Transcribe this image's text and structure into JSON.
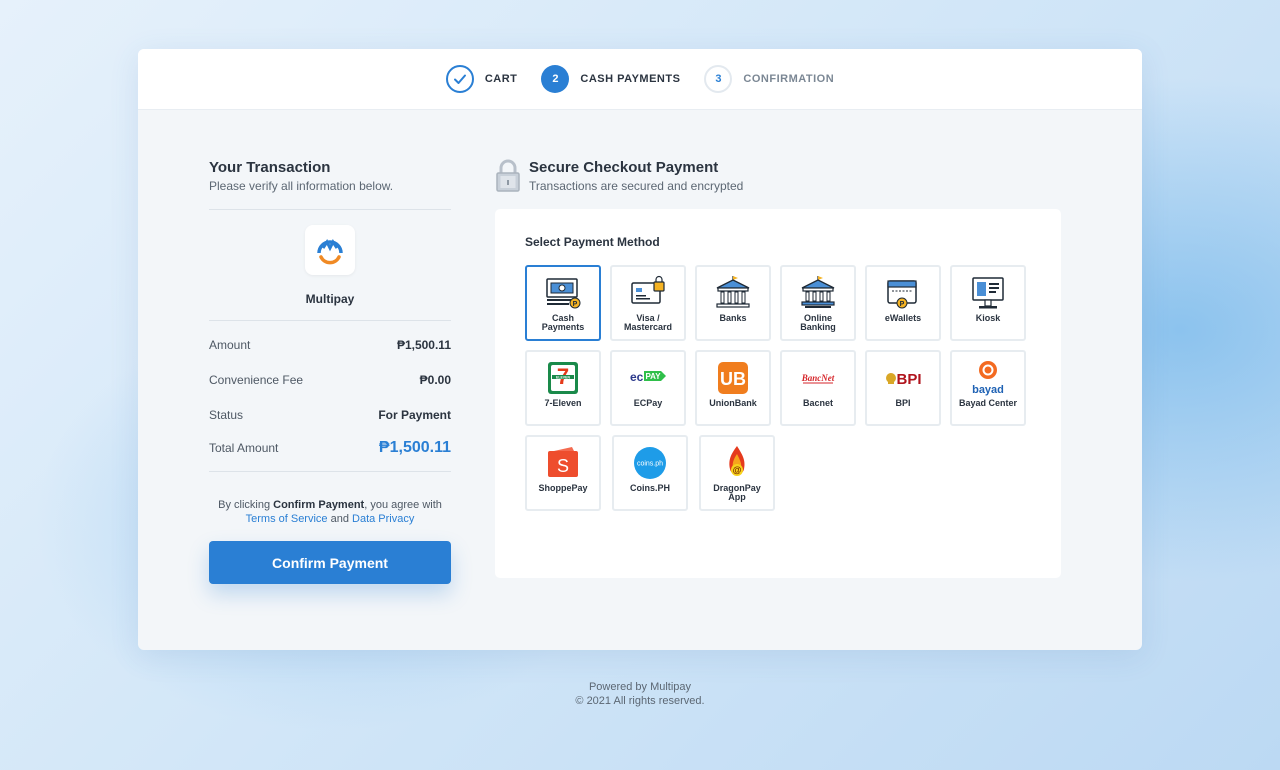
{
  "steps": [
    {
      "label": "CART",
      "number": "",
      "state": "done"
    },
    {
      "label": "CASH PAYMENTS",
      "number": "2",
      "state": "active"
    },
    {
      "label": "CONFIRMATION",
      "number": "3",
      "state": "todo"
    }
  ],
  "transaction": {
    "title": "Your Transaction",
    "subtitle": "Please verify all information below.",
    "merchant_name": "Multipay",
    "amount_label": "Amount",
    "amount_value": "₱1,500.11",
    "fee_label": "Convenience Fee",
    "fee_value": "₱0.00",
    "status_label": "Status",
    "status_value": "For Payment",
    "total_label": "Total Amount",
    "total_value": "₱1,500.11"
  },
  "agreement": {
    "prefix": "By clicking ",
    "action": "Confirm Payment",
    "middle": ", you agree with",
    "terms": "Terms of Service",
    "and": " and ",
    "privacy": "Data Privacy"
  },
  "confirm_button": "Confirm Payment",
  "secure": {
    "title": "Secure Checkout Payment",
    "subtitle": "Transactions are secured and encrypted"
  },
  "payment_panel": {
    "title": "Select Payment Method",
    "methods": [
      {
        "label": "Cash Payments",
        "icon": "cash-icon",
        "selected": true
      },
      {
        "label": "Visa / Mastercard",
        "icon": "card-icon"
      },
      {
        "label": "Banks",
        "icon": "bank-icon"
      },
      {
        "label": "Online Banking",
        "icon": "online-bank-icon"
      },
      {
        "label": "eWallets",
        "icon": "wallet-icon"
      },
      {
        "label": "Kiosk",
        "icon": "kiosk-icon"
      },
      {
        "label": "7-Eleven",
        "icon": "seven-eleven-logo"
      },
      {
        "label": "ECPay",
        "icon": "ecpay-logo"
      },
      {
        "label": "UnionBank",
        "icon": "unionbank-logo"
      },
      {
        "label": "Bacnet",
        "icon": "bancnet-logo"
      },
      {
        "label": "BPI",
        "icon": "bpi-logo"
      },
      {
        "label": "Bayad Center",
        "icon": "bayad-logo"
      },
      {
        "label": "ShoppePay",
        "icon": "shopeepay-logo"
      },
      {
        "label": "Coins.PH",
        "icon": "coinsph-logo"
      },
      {
        "label": "DragonPay App",
        "icon": "dragonpay-logo"
      }
    ]
  },
  "footer": {
    "line1": "Powered by Multipay",
    "line2": "© 2021 All rights reserved."
  },
  "colors": {
    "accent": "#2a7fd4",
    "text": "#2b3440",
    "muted": "#7b8794"
  }
}
